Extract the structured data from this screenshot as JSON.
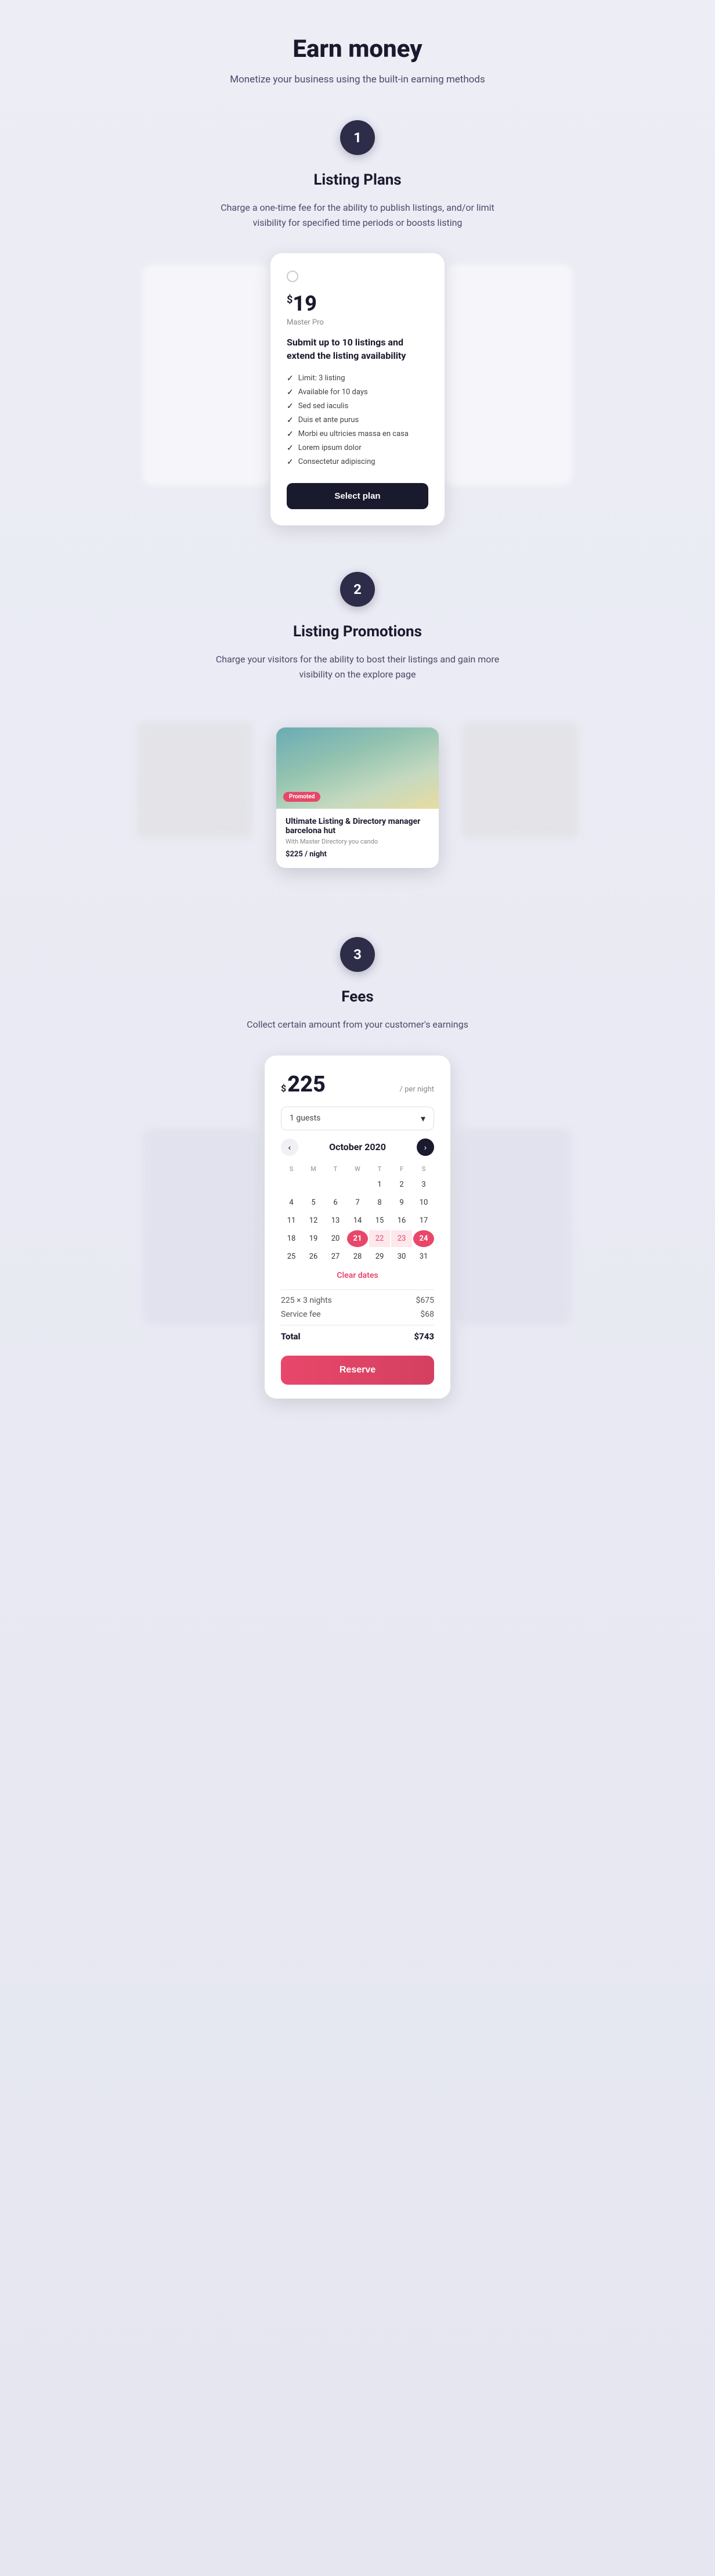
{
  "page": {
    "title": "Earn money",
    "subtitle": "Monetize your business using the built-in earning methods"
  },
  "section1": {
    "step": "1",
    "title": "Listing Plans",
    "description": "Charge a one-time fee for the ability to publish listings, and/or limit visibility for specified time periods or boosts listing",
    "plan": {
      "price": "19",
      "currency": "$",
      "name": "Master Pro",
      "headline": "Submit up to 10 listings and extend the listing availability",
      "features": [
        "Limit: 3 listing",
        "Available for 10 days",
        "Sed sed iaculis",
        "Duis et ante purus",
        "Morbi eu ultricies massa en casa",
        "Lorem ipsum dolor",
        "Consectetur adipiscing"
      ],
      "button_label": "Select plan"
    }
  },
  "section2": {
    "step": "2",
    "title": "Listing Promotions",
    "description": "Charge your visitors for the ability to bost their listings and gain more visibility on the explore page",
    "promo": {
      "badge": "Promoted",
      "title": "Ultimate Listing & Directory manager barcelona hut",
      "subtitle": "With Master Directory you cando",
      "price": "$225 / night"
    }
  },
  "section3": {
    "step": "3",
    "title": "Fees",
    "description": "Collect certain amount from your customer's earnings",
    "booking": {
      "price_currency": "$",
      "price_amount": "225",
      "price_period": "/ per night",
      "guests": "1 guests",
      "guests_chevron": "▾",
      "calendar": {
        "month": "October 2020",
        "nav_prev": "‹",
        "nav_next": "›",
        "day_headers": [
          "S",
          "M",
          "T",
          "W",
          "T",
          "F",
          "S"
        ],
        "weeks": [
          [
            "",
            "",
            "",
            "",
            "1",
            "2",
            "3"
          ],
          [
            "4",
            "5",
            "6",
            "7",
            "8",
            "9",
            "10"
          ],
          [
            "11",
            "12",
            "13",
            "14",
            "15",
            "16",
            "17"
          ],
          [
            "18",
            "19",
            "20",
            "21",
            "22",
            "23",
            "24"
          ],
          [
            "25",
            "26",
            "27",
            "28",
            "29",
            "30",
            "31"
          ]
        ],
        "selected_start": "21",
        "selected_end": "24",
        "in_range": [
          "22",
          "23"
        ],
        "clear_label": "Clear dates"
      },
      "fee_rows": [
        {
          "label": "225 × 3 nights",
          "amount": "$675"
        },
        {
          "label": "Service fee",
          "amount": "$68"
        }
      ],
      "total_label": "Total",
      "total_amount": "$743",
      "reserve_label": "Reserve"
    }
  },
  "icons": {
    "check": "✓",
    "chevron_down": "▾",
    "arrow_left": "‹",
    "arrow_right": "›"
  }
}
